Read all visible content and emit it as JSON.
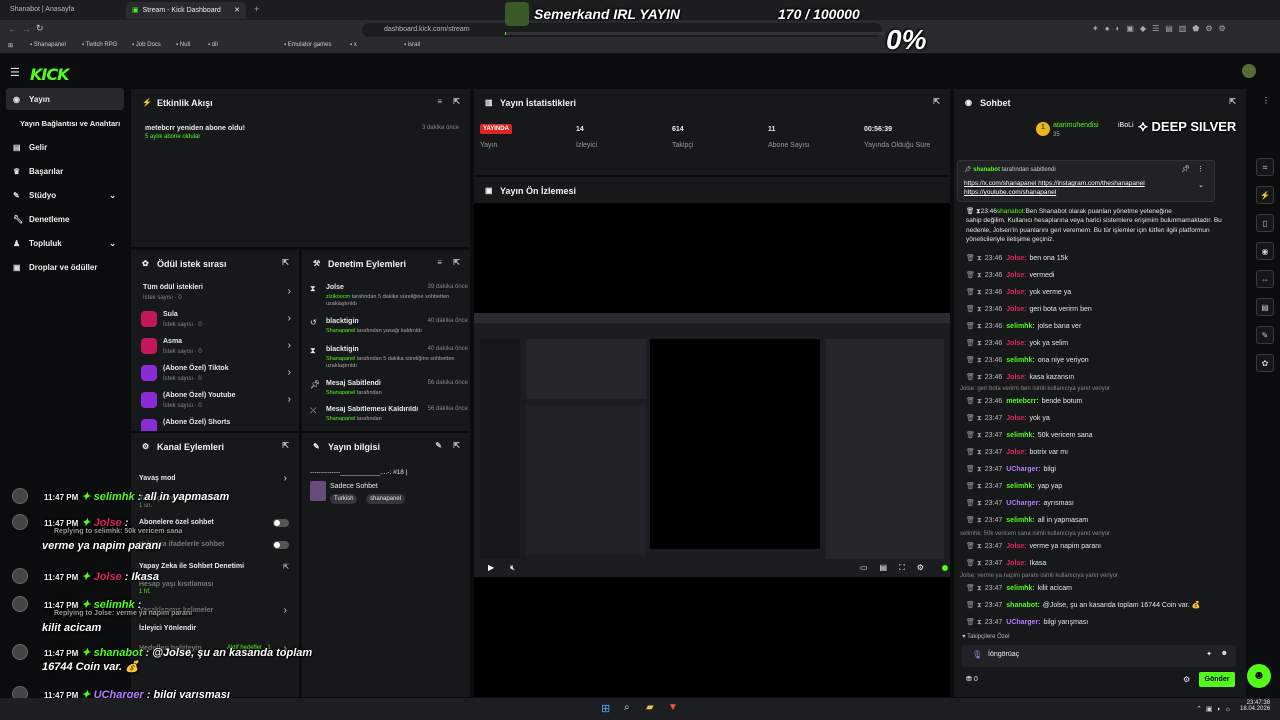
{
  "browser": {
    "tabs": [
      "Shanabot | Anasayfa",
      "Stream - Kick Dashboard"
    ],
    "url": "dashboard.kick.com/stream",
    "bookmarks": [
      "Shanapanel",
      "Twitch RPG",
      "Job Docs",
      "Null",
      "dil",
      "Emulator games",
      "x",
      "israil"
    ]
  },
  "overlay": {
    "stream_title": "Semerkand IRL YAYIN",
    "goal_progress": "170 / 100000",
    "goal_percent": "0%",
    "sponsor": "DEEP SILVER"
  },
  "kick": {
    "logo": "KICK"
  },
  "nav": {
    "items": [
      "Yayın",
      "Yayın Bağlantısı ve Anahtarı",
      "Gelir",
      "Başarılar",
      "Stüdyo",
      "Denetleme",
      "Topluluk",
      "Droplar ve ödüller"
    ]
  },
  "activity": {
    "title": "Etkinlik Akışı",
    "event_text": "metebcrr yeniden abone oldu!",
    "event_sub": "5 aylık abone oldular",
    "event_time": "3 dakika önce"
  },
  "stats": {
    "title": "Yayın İstatistikleri",
    "live_badge": "YAYINDA",
    "live_label": "Yayın",
    "items": [
      {
        "value": "14",
        "label": "İzleyici"
      },
      {
        "value": "614",
        "label": "Takipçi"
      },
      {
        "value": "11",
        "label": "Abone Sayısı"
      },
      {
        "value": "00:56:39",
        "label": "Yayında Olduğu Süre"
      }
    ]
  },
  "preview": {
    "title": "Yayın Ön İzlemesi"
  },
  "rewards": {
    "title": "Ödül istek sırası",
    "items": [
      {
        "name": "Tüm ödül istekleri",
        "sub": "İstek sayısı · 0"
      },
      {
        "name": "Sula",
        "sub": "İstek sayısı · 0"
      },
      {
        "name": "Asma",
        "sub": "İstek sayısı · 0"
      },
      {
        "name": "(Abone Özel) Tiktok",
        "sub": "İstek sayısı · 0"
      },
      {
        "name": "(Abone Özel) Youtube",
        "sub": "İstek sayısı · 0"
      },
      {
        "name": "(Abone Özel) Shorts",
        "sub": ""
      }
    ]
  },
  "moderation": {
    "title": "Denetim Eylemleri",
    "items": [
      {
        "user": "Jolse",
        "time": "39 dakika önce",
        "by": "zizikoocm",
        "text": "tarafından 5 dakika süreliğine sohbetten uzaklaştırıldı"
      },
      {
        "user": "blacktigin",
        "time": "40 dakika önce",
        "by": "Shanapanel",
        "text": "tarafından yasağı kaldırıldı"
      },
      {
        "user": "blacktigin",
        "time": "40 dakika önce",
        "by": "Shanapanel",
        "text": "tarafından 5 dakika süreliğine sohbetten uzaklaştırıldı"
      },
      {
        "user": "Mesaj Sabitlendi",
        "time": "56 dakika önce",
        "by": "Shanapanel",
        "text": "tarafından"
      },
      {
        "user": "Mesaj Sabitlemesi Kaldırıldı",
        "time": "56 dakika önce",
        "by": "Shanapanel",
        "text": "tarafından"
      }
    ]
  },
  "channel_actions": {
    "title": "Kanal Eylemleri",
    "items": [
      "Yavaş mod",
      "Takipçilere özel sohbet",
      "Abonelere özel sohbet",
      "Yalnızca ifadelerle sohbet",
      "Yapay Zeka ile Sohbet Denetimi",
      "Hesap yaşı kısıtlaması",
      "Yasaklanmış kelimeler",
      "İzleyici Yönlendir",
      "Hedefleri belirleyin"
    ],
    "sub_1": "1 sn.",
    "sub_2": "1 hf.",
    "goal_status": "Aktif hedefler · 1"
  },
  "stream_info": {
    "title": "Yayın bilgisi",
    "stream_name": "--------------___________....-: #18 |",
    "category": "Sadece Sohbet",
    "tags": [
      "Turkish",
      "shanapanel"
    ]
  },
  "chat": {
    "title": "Sohbet",
    "top_user": "atarimuhendisi",
    "top_count": "35",
    "top_user2": "iBoLi",
    "pinned_by": "shanabot",
    "pinned_by_text": "tarafından sabitlendi",
    "pinned_links": "https://x.com/shanapanel https://instagram.com/theshanapanel https://youtube.com/shanapanel",
    "bot_intro_time": "23:46",
    "bot_intro_user": "shanabot:",
    "bot_intro_text": [
      "Ben Shanabot olarak puanları yönetme yeteneğine",
      "sahip değilim. Kullanıcı hesaplarına veya harici sistemlere erişimim bulunmamaktadır. Bu",
      "nedenle, Jolsen'in puanlarını geri veremem. Bu tür işlemler için lütfen ilgili platformun",
      "yöneticileriyle iletişime geçiniz."
    ],
    "messages": [
      {
        "time": "23:46",
        "user": "Jolse:",
        "text": "ben ona 15k",
        "color": "#e0245e"
      },
      {
        "time": "23:46",
        "user": "Jolse:",
        "text": "vermedi",
        "color": "#e0245e"
      },
      {
        "time": "23:46",
        "user": "Jolse:",
        "text": "yok verme ya",
        "color": "#e0245e"
      },
      {
        "time": "23:46",
        "user": "Jolse:",
        "text": "geri bota verirm ben",
        "color": "#e0245e"
      },
      {
        "time": "23:46",
        "user": "selimhk:",
        "text": "jolse bana ver",
        "color": "#53fc18"
      },
      {
        "time": "23:46",
        "user": "Jolse:",
        "text": "yok ya selim",
        "color": "#e0245e"
      },
      {
        "time": "23:46",
        "user": "selimhk:",
        "text": "ona niye veriyon",
        "color": "#53fc18"
      },
      {
        "time": "23:46",
        "user": "Jolse:",
        "text": "kasa kazansın",
        "color": "#e0245e"
      }
    ],
    "reply1": "Jolse: geri bota verirm ben isimli kullanıcıya yanıt veriyor",
    "messages2": [
      {
        "time": "23:46",
        "user": "metebcrr:",
        "text": "bende botum",
        "color": "#53fc18"
      },
      {
        "time": "23:47",
        "user": "Jolse:",
        "text": "yok ya",
        "color": "#e0245e"
      },
      {
        "time": "23:47",
        "user": "selimhk:",
        "text": "50k vericem sana",
        "color": "#53fc18"
      },
      {
        "time": "23:47",
        "user": "Jolse:",
        "text": "botrix var mı",
        "color": "#e0245e"
      },
      {
        "time": "23:47",
        "user": "UCharger:",
        "text": "bilgi",
        "color": "#b57cff"
      },
      {
        "time": "23:47",
        "user": "selimhk:",
        "text": "yap yap",
        "color": "#53fc18"
      },
      {
        "time": "23:47",
        "user": "UCharger:",
        "text": "ayrısması",
        "color": "#b57cff"
      },
      {
        "time": "23:47",
        "user": "selimhk:",
        "text": "all in yapmasam",
        "color": "#53fc18"
      }
    ],
    "reply2": "selimhk: 50k vericem sana isimli kullanıcıya yanıt veriyor",
    "messages3": [
      {
        "time": "23:47",
        "user": "Jolse:",
        "text": "verme ya napim paranı",
        "color": "#e0245e"
      },
      {
        "time": "23:47",
        "user": "Jolse:",
        "text": "Ikasa",
        "color": "#e0245e"
      }
    ],
    "reply3": "Jolse: verme ya napim paranı isimli kullanıcıya yanıt veriyor",
    "messages4": [
      {
        "time": "23:47",
        "user": "selimhk:",
        "text": "kilit acicam",
        "color": "#53fc18"
      },
      {
        "time": "23:47",
        "user": "shanabot:",
        "text": "@Jolse, şu an kasanda toplam 16744 Coin var. 💰",
        "color": "#53fc18"
      },
      {
        "time": "23:47",
        "user": "UCharger:",
        "text": "bilgi yarışması",
        "color": "#b57cff"
      }
    ],
    "followers_only": "Takipçilere Özel",
    "input_value": "İöngörüaç",
    "points": "0",
    "send_label": "Gönder"
  },
  "overlay_chat": [
    {
      "time": "11:47 PM",
      "user": "selimhk",
      "text": "all in yapmasam",
      "color": "#53fc18"
    },
    {
      "time": "11:47 PM",
      "user": "Jolse",
      "text": "",
      "color": "#e0245e",
      "reply": "Replying to selimhk: 50k vericem sana",
      "text2": "verme ya napim paranı"
    },
    {
      "time": "11:47 PM",
      "user": "Jolse",
      "text": "Ikasa",
      "color": "#e0245e"
    },
    {
      "time": "11:47 PM",
      "user": "selimhk",
      "text": "",
      "color": "#53fc18",
      "reply": "Replying to Jolse: verme ya napim paranı",
      "text2": "kilit acicam"
    },
    {
      "time": "11:47 PM",
      "user": "shanabot",
      "text": "@Jolse, şu an kasanda toplam",
      "color": "#53fc18",
      "text2": "16744 Coin var. 💰"
    },
    {
      "time": "11:47 PM",
      "user": "UCharger",
      "text": "bilgi yarışması",
      "color": "#b57cff"
    }
  ],
  "taskbar": {
    "time": "23:47:38",
    "date": "18.04.2026"
  }
}
